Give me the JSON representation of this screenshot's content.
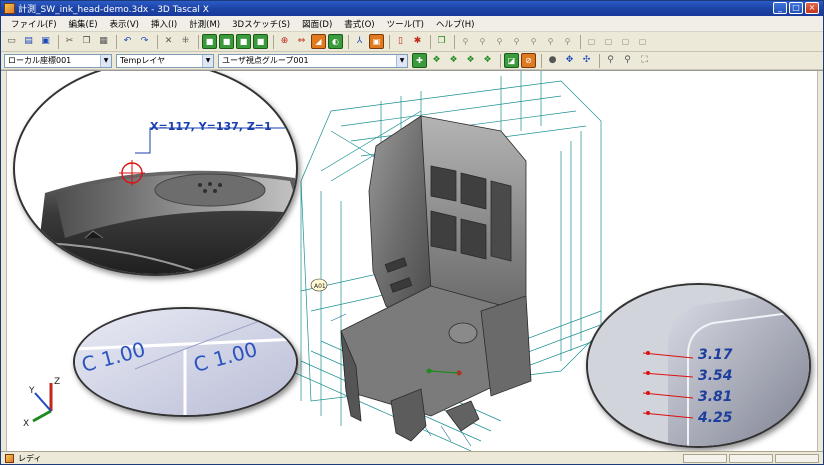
{
  "window": {
    "title": "計測_SW_ink_head-demo.3dx - 3D Tascal X",
    "controls": [
      "_",
      "□",
      "×"
    ]
  },
  "menu": {
    "items": [
      "ファイル(F)",
      "編集(E)",
      "表示(V)",
      "挿入(I)",
      "計測(M)",
      "3Dスケッチ(S)",
      "図面(D)",
      "書式(O)",
      "ツール(T)",
      "ヘルプ(H)"
    ]
  },
  "toolbar2": {
    "coordinate_system": "ローカル座標001",
    "layer": "Tempレイヤ",
    "viewpoint_group": "ユーザ視点グループ001"
  },
  "viewport": {
    "coord_readout": "X=117, Y=137, Z=1",
    "chamfer_label": "C 1.00",
    "fillet_dimensions": [
      "3.17",
      "3.54",
      "3.81",
      "4.25"
    ],
    "triad_axes": [
      "Z",
      "Y",
      "X"
    ],
    "dimension_callout": "A01"
  },
  "statusbar": {
    "text": "レディ"
  },
  "colors": {
    "titlebar": "#1d44a6",
    "dimension_blue": "#1a3fb0",
    "wireframe_teal": "#1b8f8f",
    "leader_red": "#c1271c"
  }
}
